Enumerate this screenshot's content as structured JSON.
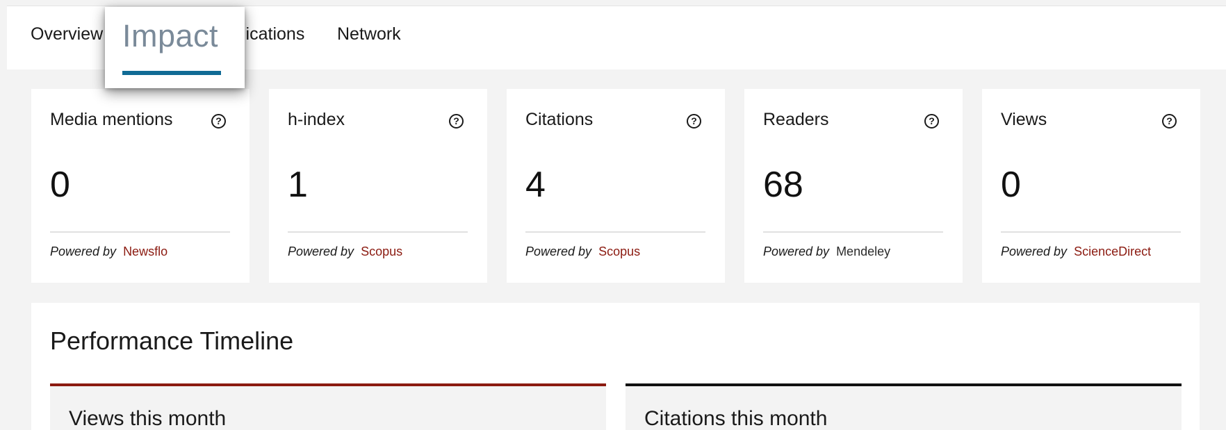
{
  "nav": {
    "tabs": {
      "overview": "Overview",
      "impact": "Impact",
      "publications": "lications",
      "network": "Network"
    },
    "active_tab": "Impact",
    "accent_color": "#106b95"
  },
  "metrics": [
    {
      "title": "Media mentions",
      "value": "0",
      "powered_label": "Powered by",
      "source": "Newsflo"
    },
    {
      "title": "h-index",
      "value": "1",
      "powered_label": "Powered by",
      "source": "Scopus"
    },
    {
      "title": "Citations",
      "value": "4",
      "powered_label": "Powered by",
      "source": "Scopus"
    },
    {
      "title": "Readers",
      "value": "68",
      "powered_label": "Powered by",
      "source": "Mendeley"
    },
    {
      "title": "Views",
      "value": "0",
      "powered_label": "Powered by",
      "source": "ScienceDirect"
    }
  ],
  "help_icon": {
    "name": "question-circle-icon",
    "glyph": "?"
  },
  "timeline": {
    "title": "Performance Timeline",
    "panels": {
      "views": "Views this month",
      "citations": "Citations this month"
    }
  },
  "colors": {
    "source_link": "#8b1a10",
    "views_panel_accent": "#8b1a10",
    "citations_panel_accent": "#111111"
  }
}
